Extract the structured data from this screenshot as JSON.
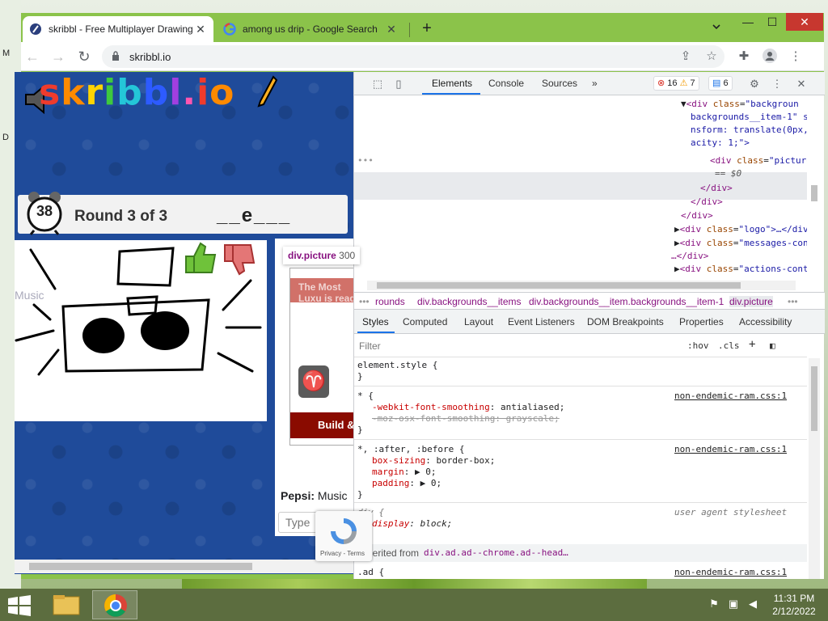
{
  "desktop": {
    "side_labels": [
      "M",
      "D"
    ]
  },
  "browser": {
    "tabs": [
      {
        "title": "skribbl - Free Multiplayer Drawing",
        "close": "✕",
        "active": true
      },
      {
        "title": "among us drip - Google Search",
        "close": "✕",
        "active": false
      }
    ],
    "new_tab": "+",
    "url": "skribbl.io",
    "window_controls": {
      "minimize": "—",
      "maximize": "☐",
      "close": "✕"
    }
  },
  "page": {
    "logo_letters": [
      "s",
      "k",
      "r",
      "i",
      "b",
      "b",
      "l",
      ".",
      "i",
      "o"
    ],
    "timer": "38",
    "round_text": "Round 3 of 3",
    "word_hint": "__e___",
    "music_ghost": "Music",
    "ad_tooltip": {
      "selector": "div.picture",
      "size": "300"
    },
    "ad_text": "The Most Luxu is ready to imp",
    "ad_cta": "Build & Pric",
    "chat": {
      "author": "Pepsi:",
      "message": "Music"
    },
    "chat_placeholder": "Type",
    "recaptcha_terms": "Privacy - Terms"
  },
  "devtools": {
    "tabs": [
      "Elements",
      "Console",
      "Sources"
    ],
    "more": "»",
    "errors": "16",
    "warnings": "7",
    "messages": "6",
    "dom_lines": {
      "l1_tag": "<div",
      "l1_attr": "class",
      "l1_val": "\"backgroun",
      "l2": "backgrounds__item-1\" st",
      "l3": "nsform: translate(0px,",
      "l4": "acity: 1;\">",
      "l5_tag": "<div",
      "l5_attr": "class",
      "l5_val": "\"picture",
      "l6": "== $0",
      "l7": "</div>",
      "l8": "</div>",
      "l9": "</div>",
      "l10_tag": "<div",
      "l10_attr": "class",
      "l10_val": "\"logo\">…</div>",
      "l11_tag": "<div",
      "l11_attr": "class",
      "l11_val": "\"messages-cont",
      "l12": "…</div>",
      "l13_tag": "<div",
      "l13_attr": "class",
      "l13_val": "\"actions-conta",
      "l14": "</div>"
    },
    "breadcrumbs": [
      "rounds",
      "div.backgrounds__items",
      "div.backgrounds__item.backgrounds__item-1",
      "div.picture"
    ],
    "subtabs": [
      "Styles",
      "Computed",
      "Layout",
      "Event Listeners",
      "DOM Breakpoints",
      "Properties",
      "Accessibility"
    ],
    "filter_placeholder": "Filter",
    "hov": ":hov",
    "cls": ".cls",
    "styles": {
      "element_style": "element.style {",
      "close_brace": "}",
      "rule1_selector": "* {",
      "rule1_source": "non-endemic-ram.css:1",
      "rule1_p1": "-webkit-font-smoothing",
      "rule1_v1": "antialiased;",
      "rule1_p2": "-moz-osx-font-smoothing: grayscale;",
      "rule2_selector": "*, :after, :before {",
      "rule2_source": "non-endemic-ram.css:1",
      "rule2_p1": "box-sizing",
      "rule2_v1": "border-box;",
      "rule2_p2": "margin",
      "rule2_v2": "0;",
      "rule2_p3": "padding",
      "rule2_v3": "0;",
      "rule3_selector": "div {",
      "rule3_source": "user agent stylesheet",
      "rule3_p1": "display",
      "rule3_v1": "block;",
      "inherited_label": "Inherited from",
      "inherited_from": "div.ad.ad--chrome.ad--head…",
      "rule4_selector": ".ad {",
      "rule4_source": "non-endemic-ram.css:1"
    }
  },
  "taskbar": {
    "time": "11:31 PM",
    "date": "2/12/2022"
  },
  "colors": {
    "chrome_frame": "#8bc34a",
    "devtools_accent": "#1a73e8",
    "tag_color": "#881280",
    "page_bg": "#1f4b9a"
  }
}
